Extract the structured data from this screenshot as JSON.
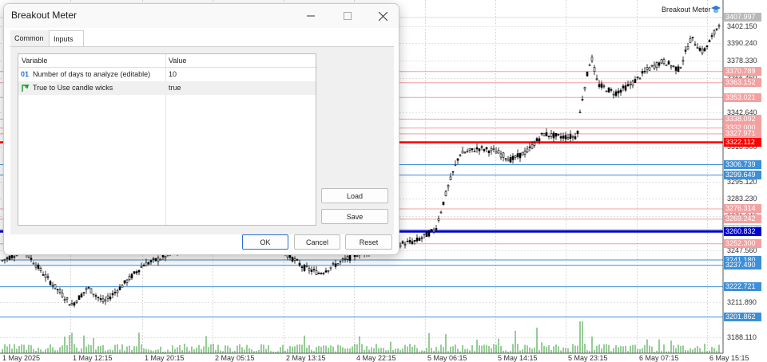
{
  "dialog": {
    "title": "Breakout Meter",
    "tabs": [
      {
        "label": "Common",
        "active": false
      },
      {
        "label": "Inputs",
        "active": true
      }
    ],
    "table": {
      "headers": [
        "Variable",
        "Value"
      ],
      "rows": [
        {
          "icon": "int-param-icon",
          "icon_text": "01",
          "name": "Number of days to analyze (editable)",
          "value": "10"
        },
        {
          "icon": "bool-param-icon",
          "icon_text": "",
          "name": "True to Use candle wicks",
          "value": "true"
        }
      ]
    },
    "buttons": {
      "load": "Load",
      "save": "Save",
      "ok": "OK",
      "cancel": "Cancel",
      "reset": "Reset"
    }
  },
  "indicator": {
    "name": "Breakout Meter"
  },
  "price_axis": {
    "labels": [
      {
        "text": "3402.150",
        "price": 3402.15
      },
      {
        "text": "3390.240",
        "price": 3390.24
      },
      {
        "text": "3378.330",
        "price": 3378.33
      },
      {
        "text": "3366.460",
        "price": 3366.46
      },
      {
        "text": "3342.640",
        "price": 3342.64
      },
      {
        "text": "3318.900",
        "price": 3318.9
      },
      {
        "text": "3295.120",
        "price": 3295.12
      },
      {
        "text": "3283.230",
        "price": 3283.23
      },
      {
        "text": "3271.340",
        "price": 3271.34
      },
      {
        "text": "3247.560",
        "price": 3247.56
      },
      {
        "text": "3211.890",
        "price": 3211.89
      },
      {
        "text": "3188.110",
        "price": 3188.11
      }
    ],
    "tags": [
      {
        "text": "3407.997",
        "price": 3407.997,
        "kind": "current"
      },
      {
        "text": "3370.789",
        "price": 3370.789,
        "kind": "red"
      },
      {
        "text": "3363.152",
        "price": 3363.152,
        "kind": "red"
      },
      {
        "text": "3353.021",
        "price": 3353.021,
        "kind": "red"
      },
      {
        "text": "3338.092",
        "price": 3338.092,
        "kind": "red"
      },
      {
        "text": "3332.000",
        "price": 3332.0,
        "kind": "red"
      },
      {
        "text": "3327.971",
        "price": 3327.971,
        "kind": "red"
      },
      {
        "text": "3322.112",
        "price": 3322.112,
        "kind": "redbold"
      },
      {
        "text": "3306.739",
        "price": 3306.739,
        "kind": "blue"
      },
      {
        "text": "3299.649",
        "price": 3299.649,
        "kind": "blue"
      },
      {
        "text": "3276.314",
        "price": 3276.314,
        "kind": "red"
      },
      {
        "text": "3269.242",
        "price": 3269.242,
        "kind": "red"
      },
      {
        "text": "3262.101",
        "price": 3262.101,
        "kind": "lightblue"
      },
      {
        "text": "3260.832",
        "price": 3260.832,
        "kind": "bluebold"
      },
      {
        "text": "3252.300",
        "price": 3252.3,
        "kind": "red"
      },
      {
        "text": "3241.180",
        "price": 3241.18,
        "kind": "blue"
      },
      {
        "text": "3237.490",
        "price": 3237.49,
        "kind": "blue"
      },
      {
        "text": "3222.721",
        "price": 3222.721,
        "kind": "blue"
      },
      {
        "text": "3201.862",
        "price": 3201.862,
        "kind": "blue"
      }
    ]
  },
  "time_axis": [
    "1 May 2025",
    "1 May 12:15",
    "1 May 20:15",
    "2 May 05:15",
    "2 May 13:15",
    "4 May 22:15",
    "5 May 06:15",
    "5 May 14:15",
    "5 May 23:15",
    "6 May 07:15",
    "6 May 15:15"
  ],
  "colors": {
    "red_level": "#f2a0a0",
    "red_bold": "#ff0000",
    "blue_level": "#3d8fd8",
    "blue_bold": "#0000cc",
    "light_blue": "#9cc9ef",
    "volume": "#2e9a2e",
    "candle": "#000000"
  }
}
